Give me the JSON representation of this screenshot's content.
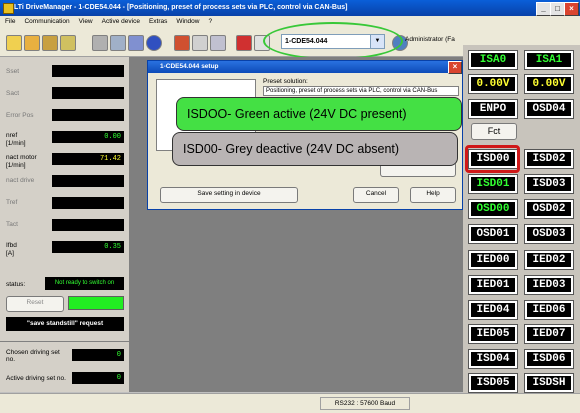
{
  "window": {
    "title": "LTi DriveManager - 1-CDE54.044 - [Positioning, preset of process sets via PLC, control via CAN-Bus]"
  },
  "menu": [
    "File",
    "Communication",
    "View",
    "Active device",
    "Extras",
    "Window",
    "?"
  ],
  "toolbar": {
    "device_select": "1-CDE54.044",
    "user_label": "Administrator (Fa"
  },
  "left_panel": {
    "fields": [
      {
        "label": "Sset",
        "value": ""
      },
      {
        "label": "Sact",
        "value": ""
      },
      {
        "label": "Error Pos",
        "value": ""
      },
      {
        "label": "nref",
        "sub": "[1/min]",
        "value": "0.00"
      },
      {
        "label": "nact motor",
        "sub": "[1/min]",
        "value": "71.42"
      },
      {
        "label": "nact drive",
        "sub": "",
        "value": ""
      },
      {
        "label": "Tref",
        "sub": "",
        "value": ""
      },
      {
        "label": "Tact",
        "sub": "",
        "value": ""
      },
      {
        "label": "Ifbd",
        "sub": "[A]",
        "value": "0.35"
      }
    ],
    "status_label": "status:",
    "status_value": "Not ready to switch on",
    "reset_label": "Reset",
    "standstill_label": "\"save standstill\" request",
    "chosen_label": "Chosen driving set no.",
    "chosen_value": "0",
    "active_label": "Active driving set no.",
    "active_value": "0"
  },
  "dialog": {
    "title": "1-CDE54.044 setup",
    "preset_label": "Preset solution:",
    "preset_value": "Positioning, preset of process sets via PLC, control via CAN-Bus",
    "save_button": "Save setting in device",
    "cancel_button": "Cancel",
    "help_button": "Help"
  },
  "callouts": {
    "green": "ISDOO- Green active (24V DC present)",
    "grey": "ISD00-  Grey deactive (24V DC absent)"
  },
  "io_panel": {
    "items": [
      {
        "label": "ISA0",
        "color": "#32ff32"
      },
      {
        "label": "ISA1",
        "color": "#32ff32"
      },
      {
        "label": "0.00V",
        "color": "#ffff32"
      },
      {
        "label": "0.00V",
        "color": "#ffff32"
      },
      {
        "label": "ENPO",
        "color": "#ffffff"
      },
      {
        "label": "OSD04",
        "color": "#ffffff"
      },
      {
        "label": "ISD00",
        "color": "#ffffff"
      },
      {
        "label": "ISD02",
        "color": "#ffffff"
      },
      {
        "label": "ISD01",
        "color": "#32ff32"
      },
      {
        "label": "ISD03",
        "color": "#ffffff"
      },
      {
        "label": "OSD00",
        "color": "#32ff32"
      },
      {
        "label": "OSD02",
        "color": "#ffffff"
      },
      {
        "label": "OSD01",
        "color": "#ffffff"
      },
      {
        "label": "OSD03",
        "color": "#ffffff"
      },
      {
        "label": "IED00",
        "color": "#ffffff"
      },
      {
        "label": "IED02",
        "color": "#ffffff"
      },
      {
        "label": "IED01",
        "color": "#ffffff"
      },
      {
        "label": "IED03",
        "color": "#ffffff"
      },
      {
        "label": "IED04",
        "color": "#ffffff"
      },
      {
        "label": "IED06",
        "color": "#ffffff"
      },
      {
        "label": "IED05",
        "color": "#ffffff"
      },
      {
        "label": "IED07",
        "color": "#ffffff"
      },
      {
        "label": "ISD04",
        "color": "#ffffff"
      },
      {
        "label": "ISD06",
        "color": "#ffffff"
      },
      {
        "label": "ISD05",
        "color": "#ffffff"
      },
      {
        "label": "ISDSH",
        "color": "#ffffff"
      }
    ],
    "fct_label": "Fct"
  },
  "statusbar": {
    "text": "RS232 : 57600 Baud"
  },
  "colors": {
    "highlight_red": "#d01818",
    "callout_green": "#44e044",
    "callout_grey": "#b9b4b4"
  }
}
